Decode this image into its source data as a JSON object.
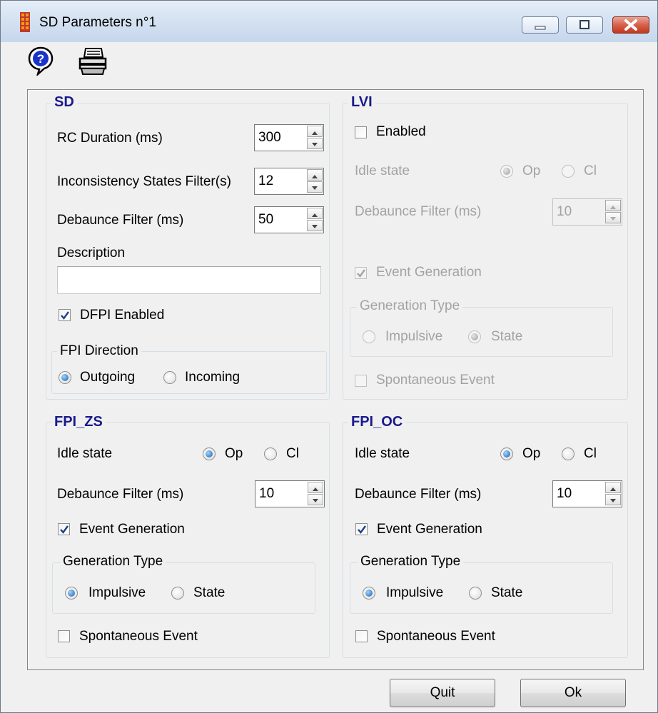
{
  "window": {
    "title": "SD Parameters n°1",
    "app_icon": "relay-icon",
    "controls": [
      "minimize-icon",
      "maximize-icon",
      "close-icon"
    ]
  },
  "toolbar": {
    "icons": [
      "help-icon",
      "printer-icon"
    ]
  },
  "sd": {
    "title": "SD",
    "rc_duration_label": "RC Duration (ms)",
    "rc_duration_value": "300",
    "inconsistency_label": "Inconsistency States Filter(s)",
    "inconsistency_value": "12",
    "debounce_label": "Debaunce Filter (ms)",
    "debounce_value": "50",
    "description_label": "Description",
    "description_value": "",
    "dfpi_enabled_label": "DFPI Enabled",
    "dfpi_enabled_checked": true,
    "fpi_direction": {
      "title": "FPI Direction",
      "options": [
        "Outgoing",
        "Incoming"
      ],
      "selected": "Outgoing"
    }
  },
  "lvi": {
    "title": "LVI",
    "enabled_label": "Enabled",
    "enabled_checked": false,
    "idle_state_label": "Idle state",
    "idle_options": [
      "Op",
      "Cl"
    ],
    "idle_selected": "Op",
    "debounce_label": "Debaunce Filter (ms)",
    "debounce_value": "10",
    "event_generation_label": "Event Generation",
    "event_generation_checked": true,
    "generation_type": {
      "title": "Generation Type",
      "options": [
        "Impulsive",
        "State"
      ],
      "selected": "State"
    },
    "spontaneous_label": "Spontaneous Event",
    "spontaneous_checked": false
  },
  "fpi_zs": {
    "title": "FPI_ZS",
    "idle_state_label": "Idle state",
    "idle_options": [
      "Op",
      "Cl"
    ],
    "idle_selected": "Op",
    "debounce_label": "Debaunce Filter (ms)",
    "debounce_value": "10",
    "event_generation_label": "Event Generation",
    "event_generation_checked": true,
    "generation_type": {
      "title": "Generation Type",
      "options": [
        "Impulsive",
        "State"
      ],
      "selected": "Impulsive"
    },
    "spontaneous_label": "Spontaneous Event",
    "spontaneous_checked": false
  },
  "fpi_oc": {
    "title": "FPI_OC",
    "idle_state_label": "Idle state",
    "idle_options": [
      "Op",
      "Cl"
    ],
    "idle_selected": "Op",
    "debounce_label": "Debaunce Filter (ms)",
    "debounce_value": "10",
    "event_generation_label": "Event Generation",
    "event_generation_checked": true,
    "generation_type": {
      "title": "Generation Type",
      "options": [
        "Impulsive",
        "State"
      ],
      "selected": "Impulsive"
    },
    "spontaneous_label": "Spontaneous Event",
    "spontaneous_checked": false
  },
  "buttons": {
    "quit_label": "Quit",
    "ok_label": "Ok"
  }
}
